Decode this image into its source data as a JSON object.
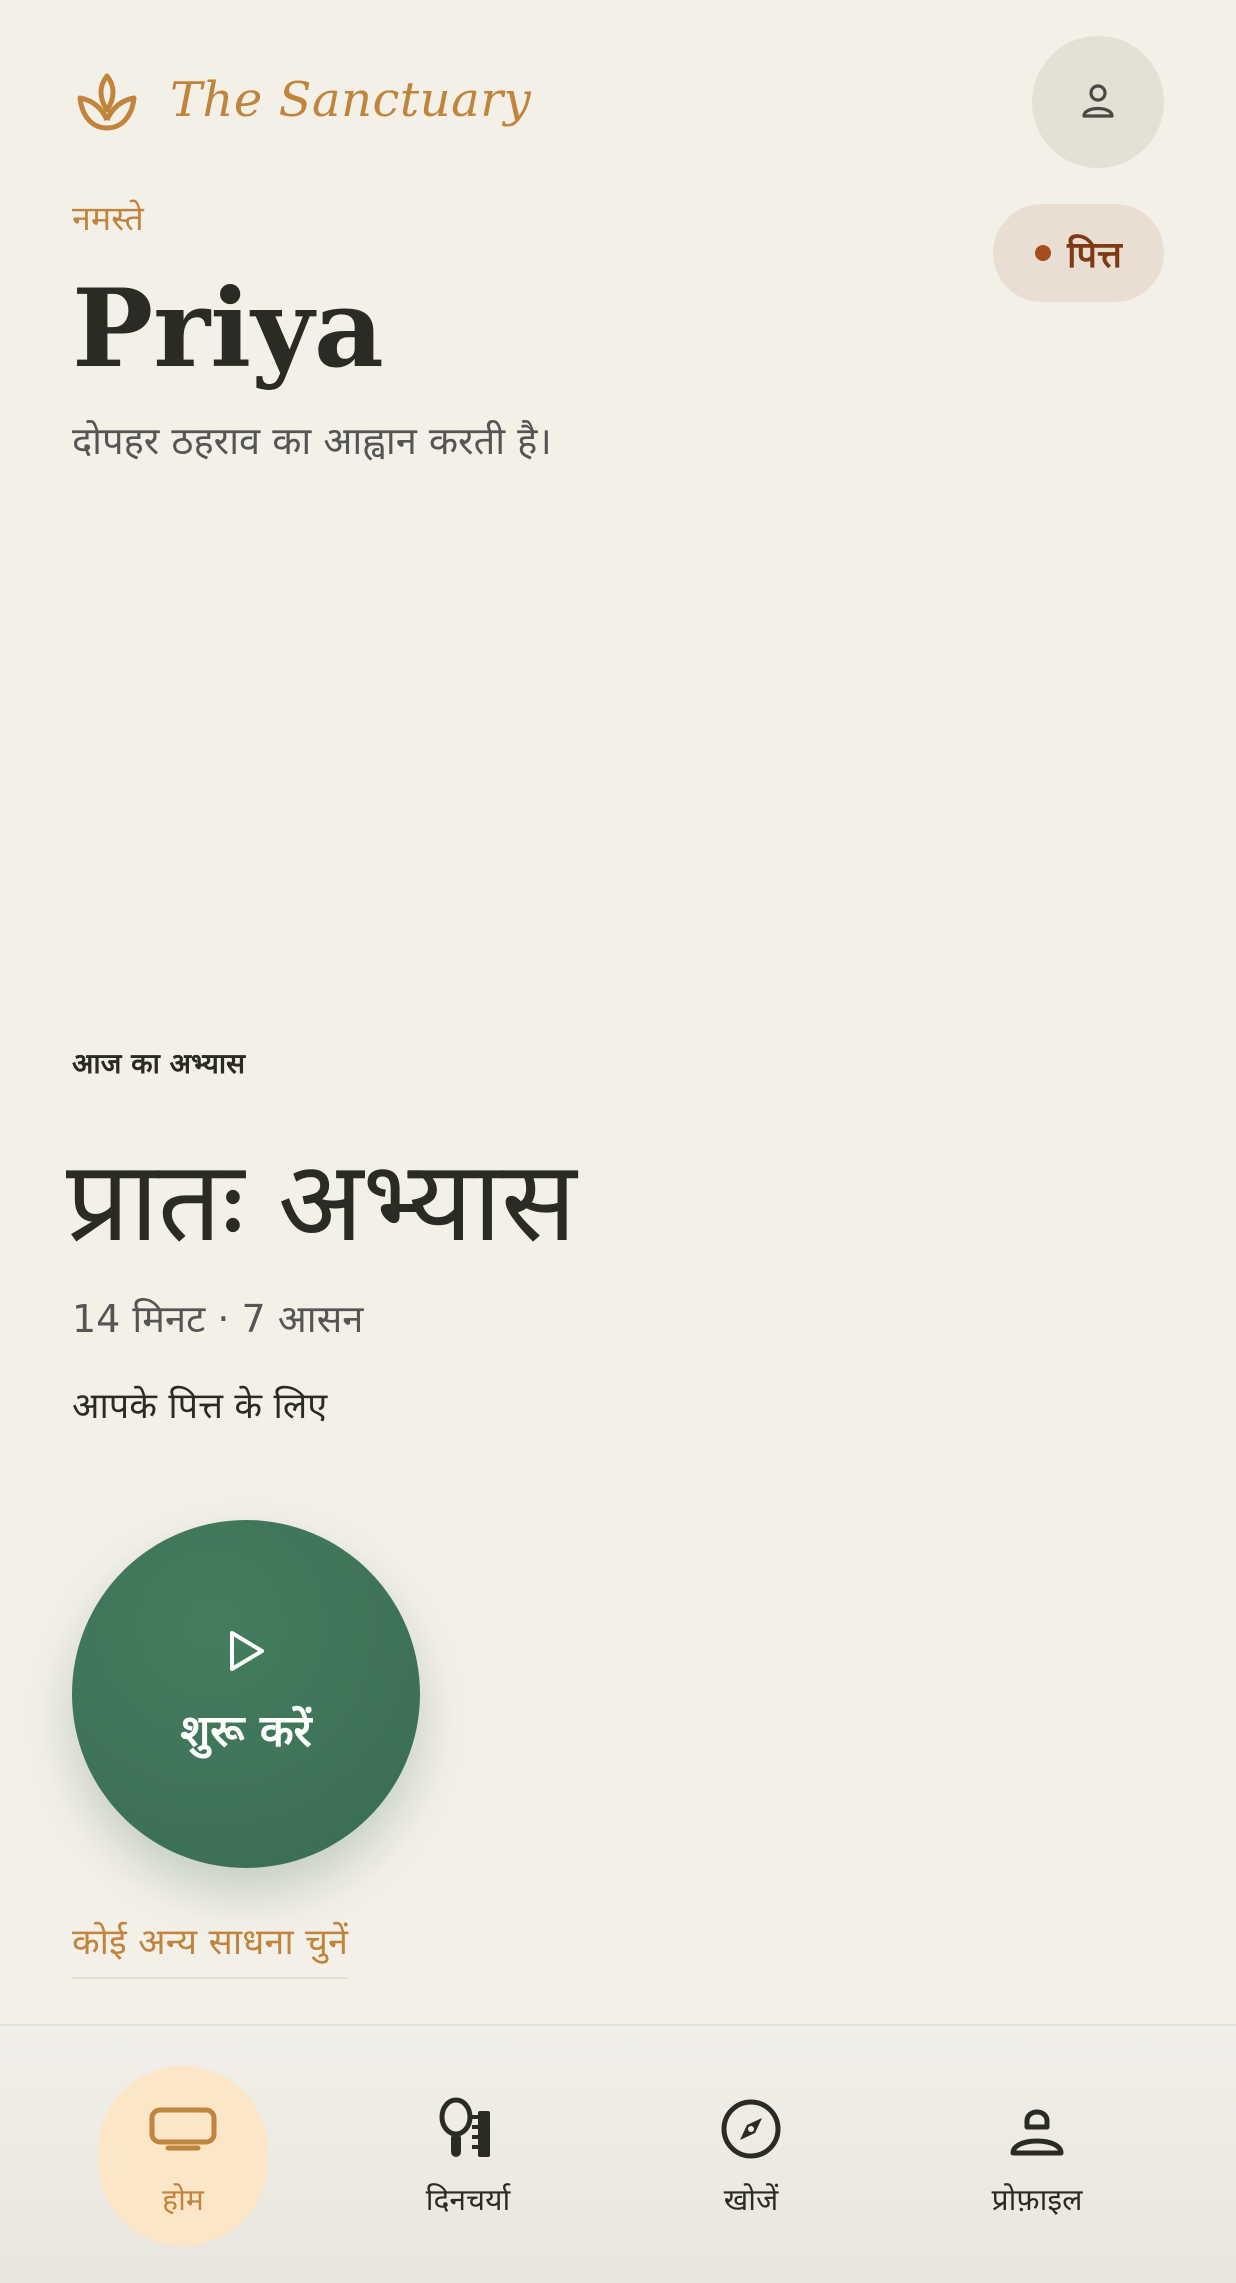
{
  "header": {
    "brand": "The Sanctuary",
    "logo_icon": "lotus-icon",
    "profile_icon": "user-icon"
  },
  "dosha": {
    "label": "पित्त"
  },
  "greeting": {
    "salutation": "नमस्ते",
    "name": "Priya",
    "subtitle": "दोपहर ठहराव का आह्वान करती है।"
  },
  "practice": {
    "section_label": "आज का अभ्यास",
    "title": "प्रातः अभ्यास",
    "meta": "14 मिनट · 7 आसन",
    "for_text": "आपके पित्त के लिए",
    "start_label": "शुरू करें",
    "start_icon": "play-icon",
    "other_link": "कोई अन्य साधना चुनें"
  },
  "nav": {
    "items": [
      {
        "label": "होम",
        "icon": "home-icon",
        "active": true
      },
      {
        "label": "दिनचर्या",
        "icon": "routine-icon",
        "active": false
      },
      {
        "label": "खोजें",
        "icon": "compass-icon",
        "active": false
      },
      {
        "label": "प्रोफ़ाइल",
        "icon": "profile-icon",
        "active": false
      }
    ]
  },
  "colors": {
    "background": "#f3f0e8",
    "accent": "#c0843c",
    "primary_green": "#3d7358",
    "dosha_text": "#7d3a14",
    "nav_active_bg": "#fce6c8"
  }
}
